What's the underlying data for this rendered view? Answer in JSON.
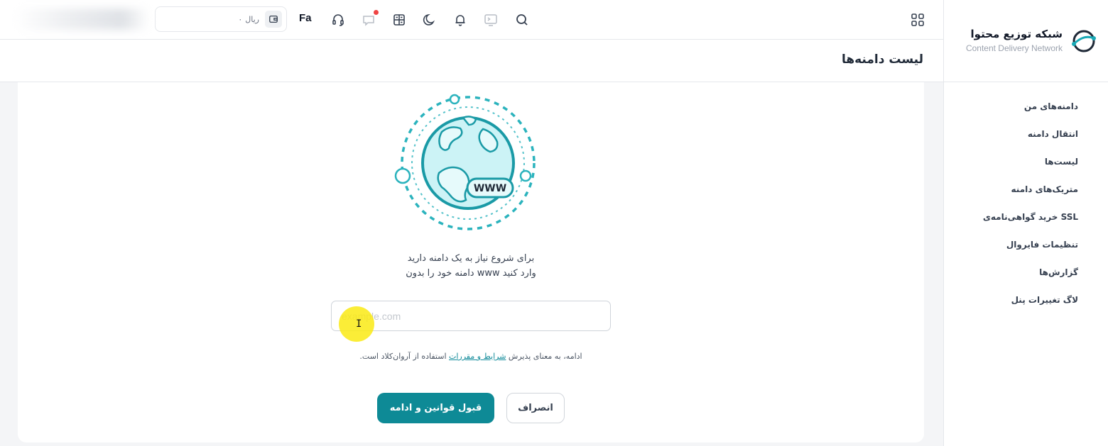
{
  "sidebar": {
    "brand_title": "شبکه توزیع محتوا",
    "brand_subtitle": "Content Delivery Network",
    "items": [
      {
        "label": "دامنه‌های من"
      },
      {
        "label": "انتقال دامنه"
      },
      {
        "label": "لیست‌ها"
      },
      {
        "label": "متریک‌های دامنه"
      },
      {
        "label": "خرید گواهی‌نامه‌ی SSL"
      },
      {
        "label": "تنظیمات فایروال"
      },
      {
        "label": "گزارش‌ها"
      },
      {
        "label": "لاگ تغییرات پنل"
      }
    ]
  },
  "topbar": {
    "language": "Fa",
    "wallet_amount": "۰",
    "wallet_currency": "ریال",
    "icons": [
      "apps-grid-icon",
      "search-icon",
      "terminal-icon",
      "bell-icon",
      "moon-icon",
      "calculator-icon",
      "chat-icon",
      "headset-icon",
      "wallet-icon"
    ]
  },
  "page": {
    "title": "لیست دامنه‌ها"
  },
  "main": {
    "illustration_label": "WWW",
    "prompt_line1": "برای شروع نیاز به یک دامنه دارید",
    "prompt_line2": "دامنه خود را بدون www وارد کنید",
    "input_placeholder": "example.com",
    "terms_before": "ادامه، به معنای پذیرش ",
    "terms_link": "شرایط و مقررات",
    "terms_after": " استفاده از آروان‌کلاد است.",
    "accept_button": "قبول قوانین و ادامه",
    "cancel_button": "انصراف"
  },
  "colors": {
    "accent": "#0e8a96",
    "illustration": "#2bb3bd",
    "notification_dot": "#ef4444"
  }
}
